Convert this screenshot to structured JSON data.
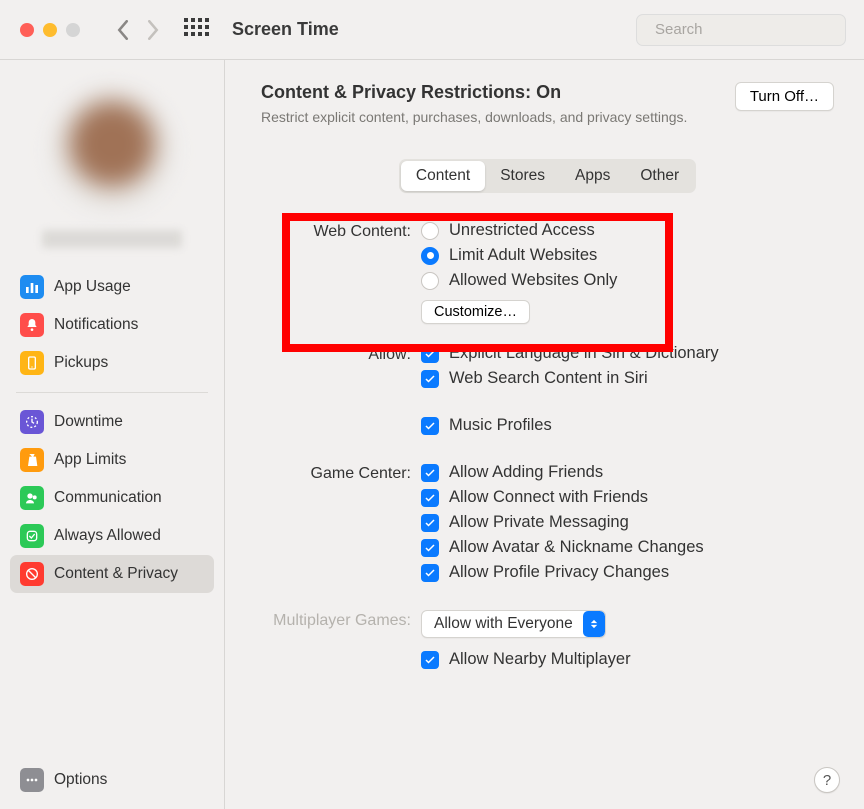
{
  "window": {
    "title": "Screen Time",
    "search_placeholder": "Search"
  },
  "sidebar": {
    "items1": [
      {
        "label": "App Usage"
      },
      {
        "label": "Notifications"
      },
      {
        "label": "Pickups"
      }
    ],
    "items2": [
      {
        "label": "Downtime"
      },
      {
        "label": "App Limits"
      },
      {
        "label": "Communication"
      },
      {
        "label": "Always Allowed"
      },
      {
        "label": "Content & Privacy"
      }
    ],
    "options_label": "Options"
  },
  "header": {
    "title_prefix": "Content & Privacy Restrictions: ",
    "title_state": "On",
    "subtitle": "Restrict explicit content, purchases, downloads, and privacy settings.",
    "turn_off": "Turn Off…"
  },
  "tabs": {
    "content": "Content",
    "stores": "Stores",
    "apps": "Apps",
    "other": "Other"
  },
  "webcontent": {
    "label": "Web Content:",
    "opt1": "Unrestricted Access",
    "opt2": "Limit Adult Websites",
    "opt3": "Allowed Websites Only",
    "customize": "Customize…"
  },
  "allow": {
    "label": "Allow:",
    "c1": "Explicit Language in Siri & Dictionary",
    "c2": "Web Search Content in Siri",
    "c3": "Music Profiles"
  },
  "gc": {
    "label": "Game Center:",
    "c1": "Allow Adding Friends",
    "c2": "Allow Connect with Friends",
    "c3": "Allow Private Messaging",
    "c4": "Allow Avatar & Nickname Changes",
    "c5": "Allow Profile Privacy Changes"
  },
  "mp": {
    "label": "Multiplayer Games:",
    "select": "Allow with Everyone",
    "nearby": "Allow Nearby Multiplayer"
  },
  "help": "?"
}
